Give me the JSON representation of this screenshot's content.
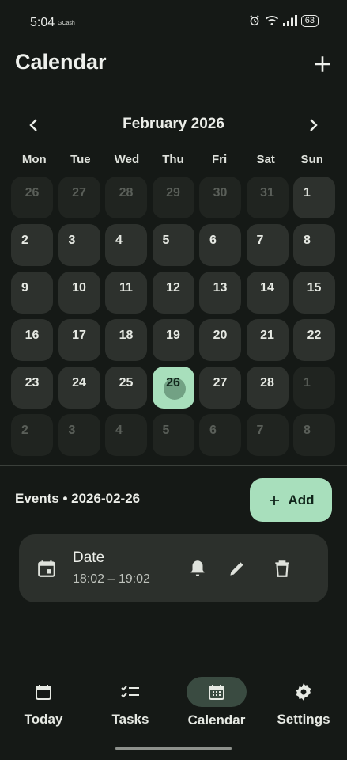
{
  "status_bar": {
    "time": "5:04",
    "carrier": "GCash",
    "battery": "63"
  },
  "header": {
    "title": "Calendar"
  },
  "month_nav": {
    "label": "February 2026"
  },
  "weekdays": [
    "Mon",
    "Tue",
    "Wed",
    "Thu",
    "Fri",
    "Sat",
    "Sun"
  ],
  "days": [
    {
      "n": "26",
      "other": true
    },
    {
      "n": "27",
      "other": true
    },
    {
      "n": "28",
      "other": true
    },
    {
      "n": "29",
      "other": true
    },
    {
      "n": "30",
      "other": true
    },
    {
      "n": "31",
      "other": true
    },
    {
      "n": "1",
      "other": false
    },
    {
      "n": "2",
      "other": false
    },
    {
      "n": "3",
      "other": false
    },
    {
      "n": "4",
      "other": false
    },
    {
      "n": "5",
      "other": false
    },
    {
      "n": "6",
      "other": false
    },
    {
      "n": "7",
      "other": false
    },
    {
      "n": "8",
      "other": false
    },
    {
      "n": "9",
      "other": false
    },
    {
      "n": "10",
      "other": false
    },
    {
      "n": "11",
      "other": false
    },
    {
      "n": "12",
      "other": false
    },
    {
      "n": "13",
      "other": false
    },
    {
      "n": "14",
      "other": false
    },
    {
      "n": "15",
      "other": false
    },
    {
      "n": "16",
      "other": false
    },
    {
      "n": "17",
      "other": false
    },
    {
      "n": "18",
      "other": false
    },
    {
      "n": "19",
      "other": false
    },
    {
      "n": "20",
      "other": false
    },
    {
      "n": "21",
      "other": false
    },
    {
      "n": "22",
      "other": false
    },
    {
      "n": "23",
      "other": false
    },
    {
      "n": "24",
      "other": false
    },
    {
      "n": "25",
      "other": false
    },
    {
      "n": "26",
      "other": false,
      "selected": true
    },
    {
      "n": "27",
      "other": false
    },
    {
      "n": "28",
      "other": false
    },
    {
      "n": "1",
      "other": true
    },
    {
      "n": "2",
      "other": true
    },
    {
      "n": "3",
      "other": true
    },
    {
      "n": "4",
      "other": true
    },
    {
      "n": "5",
      "other": true
    },
    {
      "n": "6",
      "other": true
    },
    {
      "n": "7",
      "other": true
    },
    {
      "n": "8",
      "other": true
    }
  ],
  "events": {
    "title": "Events • 2026-02-26",
    "add_label": "Add",
    "items": [
      {
        "title": "Date",
        "time": "18:02 – 19:02"
      }
    ]
  },
  "bottom_nav": {
    "items": [
      {
        "label": "Today",
        "icon": "today-icon",
        "active": false
      },
      {
        "label": "Tasks",
        "icon": "tasks-icon",
        "active": false
      },
      {
        "label": "Calendar",
        "icon": "calendar-icon",
        "active": true
      },
      {
        "label": "Settings",
        "icon": "gear-icon",
        "active": false
      }
    ]
  },
  "colors": {
    "background": "#151916",
    "accent": "#a8dfbc",
    "cell": "#2d312d",
    "cell_other": "#202420",
    "nav_pill": "#3a4b41"
  }
}
